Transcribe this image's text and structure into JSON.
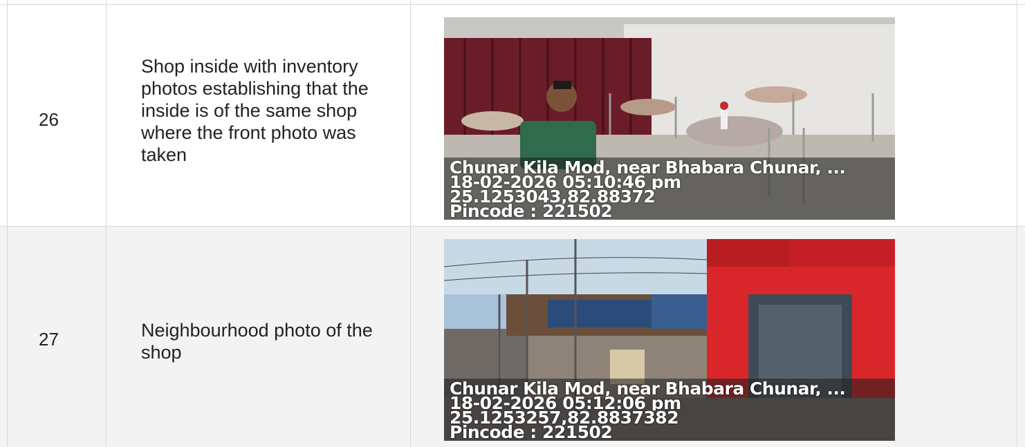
{
  "rows": [
    {
      "number": "26",
      "description": "Shop inside with inventory photos establishing that the inside is of the same shop where the front photo was taken",
      "photo": {
        "address": "Chunar Kila Mod, near Bhabara Chunar, ...",
        "datetime": "18-02-2026 05:10:46 pm",
        "coords": "25.1253043,82.88372",
        "pincode": "Pincode : 221502"
      }
    },
    {
      "number": "27",
      "description": "Neighbourhood photo of the shop",
      "photo": {
        "address": "Chunar Kila Mod, near Bhabara Chunar, ...",
        "datetime": "18-02-2026 05:12:06 pm",
        "coords": "25.1253257,82.8837382",
        "pincode": "Pincode : 221502"
      }
    }
  ]
}
